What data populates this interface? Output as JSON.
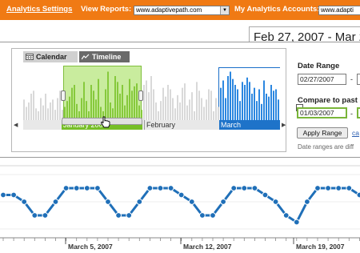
{
  "topbar": {
    "analytics_settings": "Analytics Settings",
    "view_reports_label": "View Reports:",
    "view_reports_value": "www.adaptivepath.com",
    "accounts_label": "My Analytics Accounts:",
    "accounts_value": "www.adapti"
  },
  "date_header": "Feb 27, 2007 - Mar 2",
  "tabs": {
    "calendar": "Calendar",
    "timeline": "Timeline"
  },
  "months": {
    "jan": "January 2007",
    "feb": "February",
    "mar": "March"
  },
  "form": {
    "date_range_label": "Date Range",
    "start_date": "02/27/2007",
    "compare_label": "Compare to past",
    "compare_start": "01/03/2007",
    "apply_label": "Apply Range",
    "cancel_label": "ca",
    "note": "Date ranges are diff"
  },
  "axis_dates": [
    "March 5, 2007",
    "March 12, 2007",
    "March 19, 2007"
  ],
  "colors": {
    "orange": "#f07a14",
    "green": "#76be27",
    "blue": "#1e73c9",
    "line": "#1f6fb8"
  },
  "chart_data": [
    {
      "type": "bar",
      "title": "",
      "categories": [
        "January 2007",
        "February",
        "March"
      ],
      "series": [
        {
          "values": [
            14,
            9,
            12,
            18,
            20,
            8,
            6,
            15,
            10,
            18,
            8,
            12,
            14,
            7,
            15,
            20,
            7,
            9,
            13,
            16,
            22,
            24,
            11,
            6,
            15,
            26,
            13,
            6,
            24,
            20,
            14,
            28,
            9,
            6,
            21,
            33,
            12,
            8,
            30,
            26,
            18,
            24,
            10,
            17,
            28,
            20,
            23,
            25,
            10,
            7,
            24,
            27,
            19,
            30,
            21,
            12,
            6,
            13,
            22,
            16,
            24,
            21,
            15,
            8,
            17,
            12,
            22,
            25,
            10,
            14,
            19,
            6,
            26,
            20,
            15,
            9,
            14,
            21,
            20,
            6,
            15,
            9,
            22,
            27,
            15,
            30,
            33,
            28,
            24,
            21,
            13,
            26,
            24,
            29,
            26,
            18,
            22,
            13,
            21,
            11,
            27,
            18,
            16,
            24,
            20,
            21,
            14
          ]
        }
      ]
    },
    {
      "type": "line",
      "title": "",
      "x": [
        "March 5, 2007",
        "March 12, 2007",
        "March 19, 2007"
      ],
      "series": [
        {
          "values": [
            5,
            5,
            4,
            2,
            2,
            4,
            6,
            6,
            6,
            6,
            4,
            2,
            2,
            4,
            6,
            6,
            6,
            5,
            4,
            2,
            2,
            4,
            6,
            6,
            6,
            5,
            4,
            2,
            1,
            4,
            6,
            6,
            6,
            6,
            5
          ]
        }
      ]
    }
  ]
}
